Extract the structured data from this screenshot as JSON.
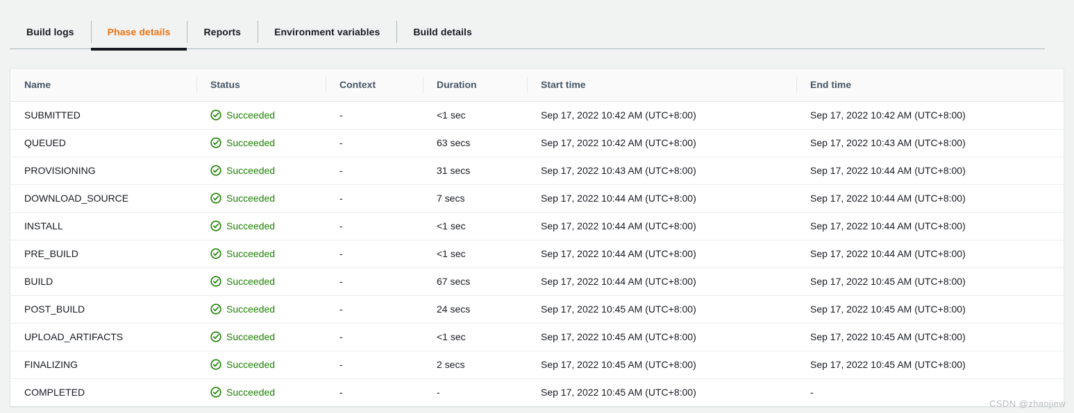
{
  "tabs": [
    {
      "label": "Build logs",
      "active": false
    },
    {
      "label": "Phase details",
      "active": true
    },
    {
      "label": "Reports",
      "active": false
    },
    {
      "label": "Environment variables",
      "active": false
    },
    {
      "label": "Build details",
      "active": false
    }
  ],
  "colors": {
    "active_tab": "#ec7211",
    "active_underline": "#16191f",
    "success_green": "#1d8102",
    "page_background": "#f1f3f3",
    "card_background": "#ffffff",
    "header_background": "#fafafa",
    "border": "#e4e6e6"
  },
  "table": {
    "columns": [
      {
        "key": "name",
        "label": "Name"
      },
      {
        "key": "status",
        "label": "Status"
      },
      {
        "key": "context",
        "label": "Context"
      },
      {
        "key": "duration",
        "label": "Duration"
      },
      {
        "key": "start_time",
        "label": "Start time"
      },
      {
        "key": "end_time",
        "label": "End time"
      }
    ],
    "status_icon": "check-circle-icon",
    "rows": [
      {
        "name": "SUBMITTED",
        "status": "Succeeded",
        "context": "-",
        "duration": "<1 sec",
        "start_time": "Sep 17, 2022 10:42 AM (UTC+8:00)",
        "end_time": "Sep 17, 2022 10:42 AM (UTC+8:00)"
      },
      {
        "name": "QUEUED",
        "status": "Succeeded",
        "context": "-",
        "duration": "63 secs",
        "start_time": "Sep 17, 2022 10:42 AM (UTC+8:00)",
        "end_time": "Sep 17, 2022 10:43 AM (UTC+8:00)"
      },
      {
        "name": "PROVISIONING",
        "status": "Succeeded",
        "context": "-",
        "duration": "31 secs",
        "start_time": "Sep 17, 2022 10:43 AM (UTC+8:00)",
        "end_time": "Sep 17, 2022 10:44 AM (UTC+8:00)"
      },
      {
        "name": "DOWNLOAD_SOURCE",
        "status": "Succeeded",
        "context": "-",
        "duration": "7 secs",
        "start_time": "Sep 17, 2022 10:44 AM (UTC+8:00)",
        "end_time": "Sep 17, 2022 10:44 AM (UTC+8:00)"
      },
      {
        "name": "INSTALL",
        "status": "Succeeded",
        "context": "-",
        "duration": "<1 sec",
        "start_time": "Sep 17, 2022 10:44 AM (UTC+8:00)",
        "end_time": "Sep 17, 2022 10:44 AM (UTC+8:00)"
      },
      {
        "name": "PRE_BUILD",
        "status": "Succeeded",
        "context": "-",
        "duration": "<1 sec",
        "start_time": "Sep 17, 2022 10:44 AM (UTC+8:00)",
        "end_time": "Sep 17, 2022 10:44 AM (UTC+8:00)"
      },
      {
        "name": "BUILD",
        "status": "Succeeded",
        "context": "-",
        "duration": "67 secs",
        "start_time": "Sep 17, 2022 10:44 AM (UTC+8:00)",
        "end_time": "Sep 17, 2022 10:45 AM (UTC+8:00)"
      },
      {
        "name": "POST_BUILD",
        "status": "Succeeded",
        "context": "-",
        "duration": "24 secs",
        "start_time": "Sep 17, 2022 10:45 AM (UTC+8:00)",
        "end_time": "Sep 17, 2022 10:45 AM (UTC+8:00)"
      },
      {
        "name": "UPLOAD_ARTIFACTS",
        "status": "Succeeded",
        "context": "-",
        "duration": "<1 sec",
        "start_time": "Sep 17, 2022 10:45 AM (UTC+8:00)",
        "end_time": "Sep 17, 2022 10:45 AM (UTC+8:00)"
      },
      {
        "name": "FINALIZING",
        "status": "Succeeded",
        "context": "-",
        "duration": "2 secs",
        "start_time": "Sep 17, 2022 10:45 AM (UTC+8:00)",
        "end_time": "Sep 17, 2022 10:45 AM (UTC+8:00)"
      },
      {
        "name": "COMPLETED",
        "status": "Succeeded",
        "context": "-",
        "duration": "-",
        "start_time": "Sep 17, 2022 10:45 AM (UTC+8:00)",
        "end_time": "-"
      }
    ]
  },
  "watermark": "CSDN @zhaojiew"
}
